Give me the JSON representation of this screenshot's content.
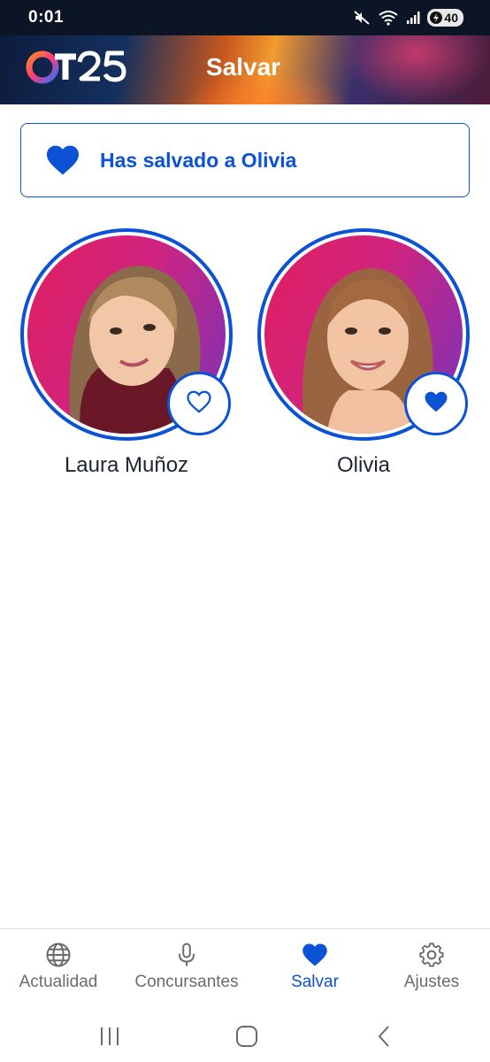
{
  "status_bar": {
    "time": "0:01",
    "battery": "40",
    "icons": [
      "mute-icon",
      "wifi-icon",
      "signal-icon",
      "battery-icon"
    ]
  },
  "header": {
    "logo_text": "OT25",
    "title": "Salvar"
  },
  "banner": {
    "text": "Has salvado a Olivia",
    "icon": "heart-filled-icon"
  },
  "contestants": [
    {
      "name": "Laura Muñoz",
      "saved": false,
      "icon": "heart-outline-icon"
    },
    {
      "name": "Olivia",
      "saved": true,
      "icon": "heart-filled-icon"
    }
  ],
  "bottom_nav": {
    "items": [
      {
        "label": "Actualidad",
        "icon": "globe-icon",
        "active": false
      },
      {
        "label": "Concursantes",
        "icon": "microphone-icon",
        "active": false
      },
      {
        "label": "Salvar",
        "icon": "heart-icon",
        "active": true
      },
      {
        "label": "Ajustes",
        "icon": "gear-icon",
        "active": false
      }
    ]
  },
  "colors": {
    "accent": "#0c52d4",
    "status_bar": "#0c1526",
    "text": "#1f2430",
    "nav_inactive": "#6b6b6b"
  }
}
